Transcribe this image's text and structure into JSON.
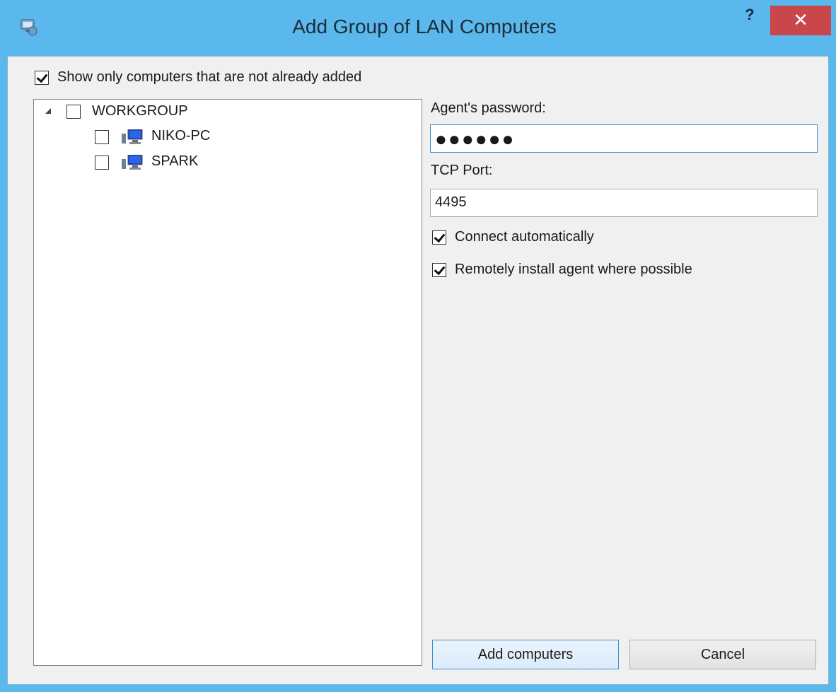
{
  "window": {
    "title": "Add Group of LAN Computers",
    "help_label": "?",
    "close_label": "✕"
  },
  "filter": {
    "show_only_new_label": "Show only computers that are not already added",
    "show_only_new_checked": true
  },
  "tree": {
    "group": {
      "label": "WORKGROUP",
      "expanded": true,
      "checked": false
    },
    "computers": [
      {
        "label": "NIKO-PC",
        "checked": false,
        "icon": "computer-icon"
      },
      {
        "label": "SPARK",
        "checked": false,
        "icon": "computer-icon"
      }
    ]
  },
  "settings": {
    "password_label": "Agent's password:",
    "password_value": "●●●●●●",
    "port_label": "TCP Port:",
    "port_value": "4495",
    "connect_auto_label": "Connect automatically",
    "connect_auto_checked": true,
    "remote_install_label": "Remotely install agent where possible",
    "remote_install_checked": true
  },
  "buttons": {
    "add_label": "Add computers",
    "cancel_label": "Cancel"
  },
  "colors": {
    "frame": "#5bb8ec",
    "close": "#c9464b",
    "focus": "#3c8fd0"
  }
}
